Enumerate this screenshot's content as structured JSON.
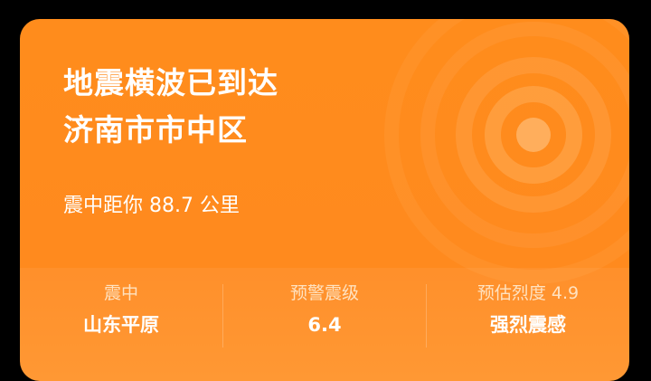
{
  "alert": {
    "title_line1": "地震横波已到达",
    "title_line2": "济南市市中区",
    "distance_text": "震中距你 88.7 公里"
  },
  "stats": [
    {
      "label": "震中",
      "value": "山东平原"
    },
    {
      "label": "预警震级",
      "value": "6.4"
    },
    {
      "label": "预估烈度 4.9",
      "value": "强烈震感"
    }
  ],
  "colors": {
    "card_background": "#ff8c1c",
    "text": "#ffffff"
  },
  "icons": {
    "decoration": "seismic-wave-ripple-icon"
  }
}
